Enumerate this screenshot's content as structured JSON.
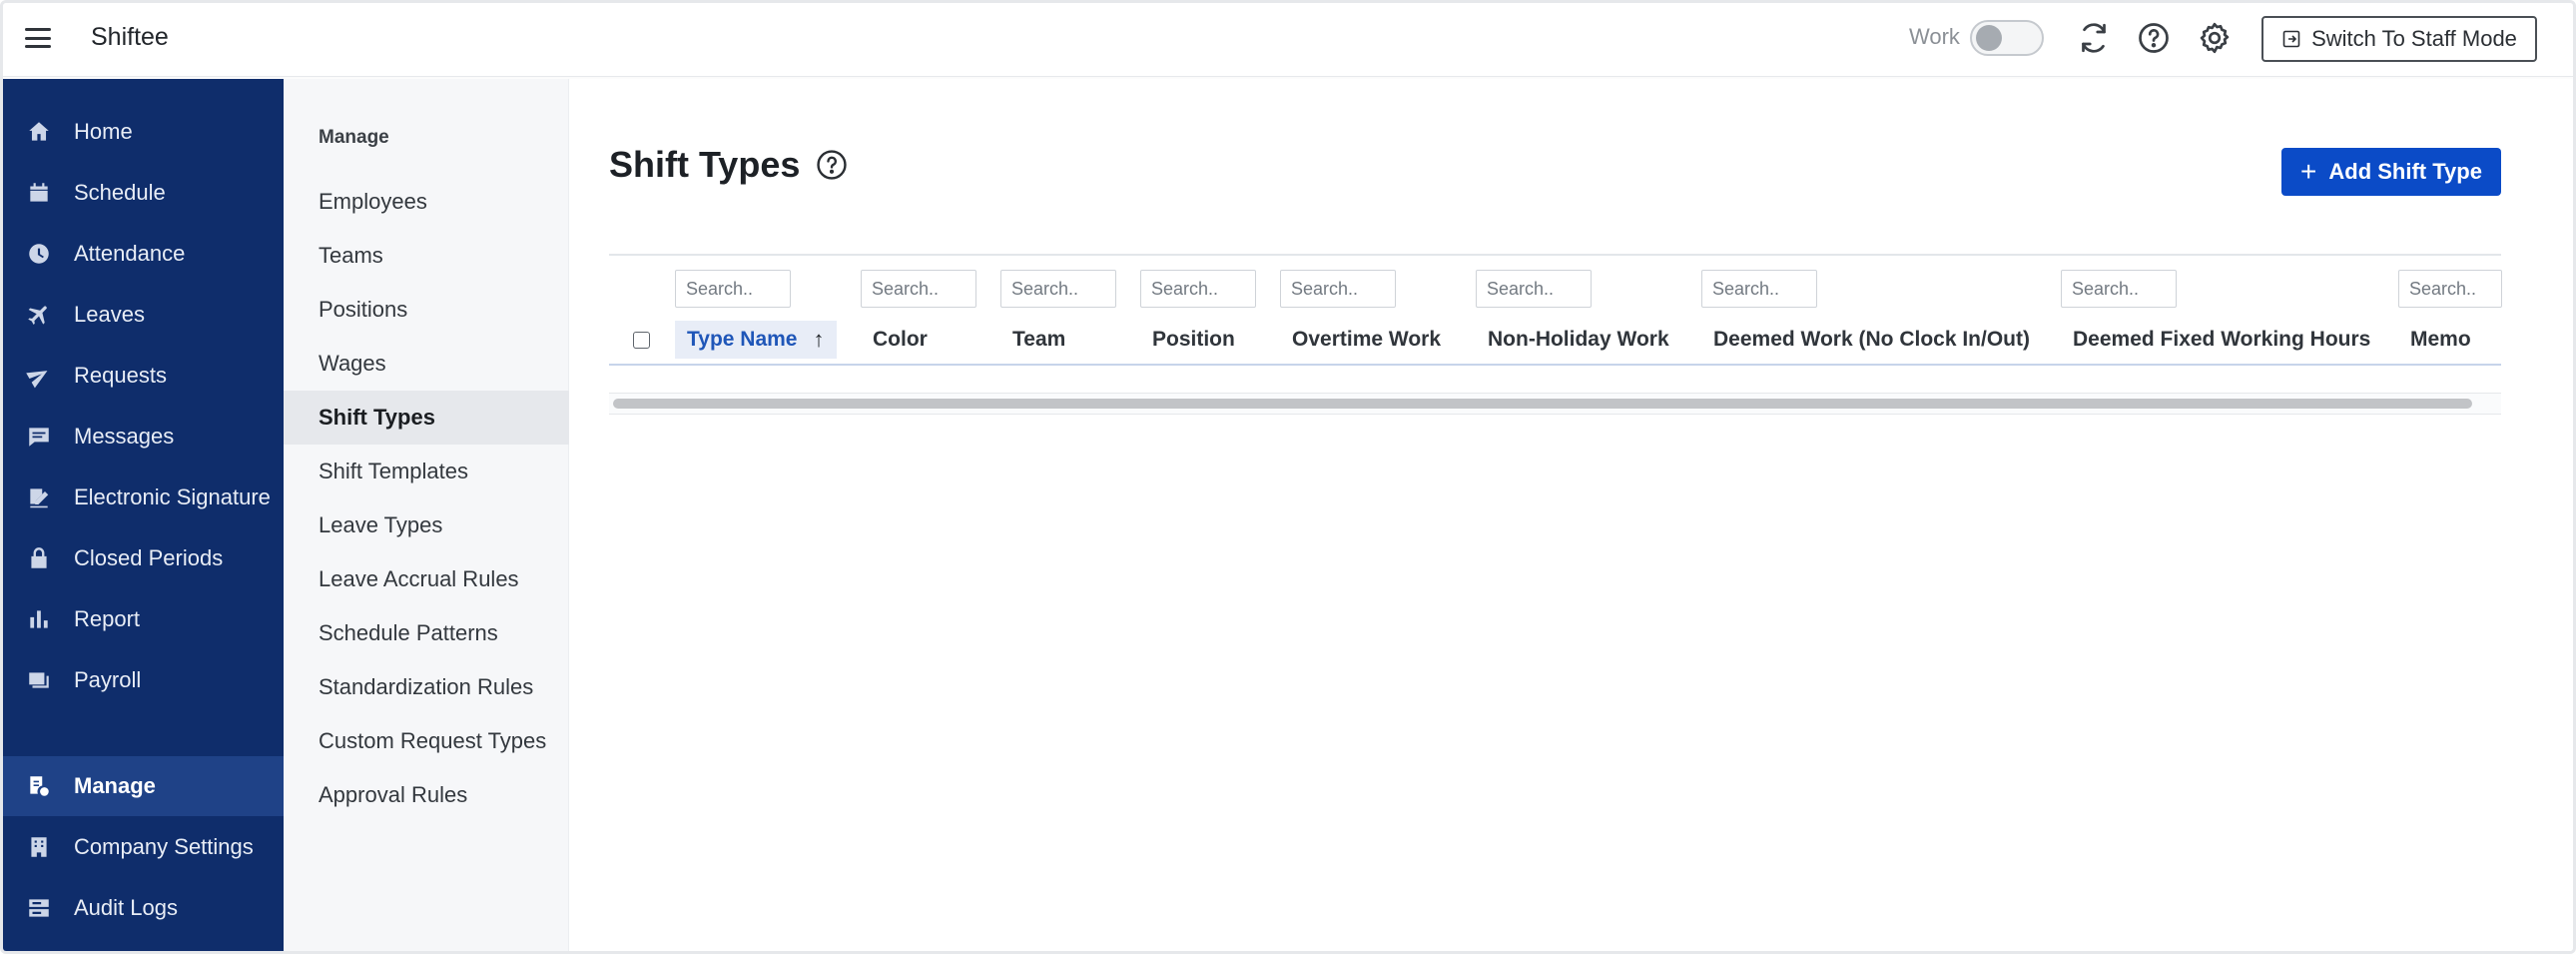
{
  "app": {
    "brand": "Shiftee"
  },
  "topbar": {
    "work_label": "Work",
    "work_toggle_on": false,
    "icons": [
      "refresh-icon",
      "help-icon",
      "gear-icon"
    ],
    "switch_button_label": "Switch To Staff Mode"
  },
  "sidebar": {
    "items": [
      {
        "label": "Home",
        "icon": "home-icon"
      },
      {
        "label": "Schedule",
        "icon": "calendar-icon"
      },
      {
        "label": "Attendance",
        "icon": "clock-icon"
      },
      {
        "label": "Leaves",
        "icon": "airplane-icon"
      },
      {
        "label": "Requests",
        "icon": "send-icon"
      },
      {
        "label": "Messages",
        "icon": "message-icon"
      },
      {
        "label": "Electronic Signature",
        "icon": "signature-icon"
      },
      {
        "label": "Closed Periods",
        "icon": "lock-icon"
      },
      {
        "label": "Report",
        "icon": "bar-chart-icon"
      },
      {
        "label": "Payroll",
        "icon": "payroll-icon"
      },
      {
        "label": "Manage",
        "icon": "manage-icon",
        "active": true
      },
      {
        "label": "Company Settings",
        "icon": "building-icon"
      },
      {
        "label": "Audit Logs",
        "icon": "audit-log-icon"
      }
    ]
  },
  "subnav": {
    "heading": "Manage",
    "items": [
      {
        "label": "Employees"
      },
      {
        "label": "Teams"
      },
      {
        "label": "Positions"
      },
      {
        "label": "Wages"
      },
      {
        "label": "Shift Types",
        "active": true
      },
      {
        "label": "Shift Templates"
      },
      {
        "label": "Leave Types"
      },
      {
        "label": "Leave Accrual Rules"
      },
      {
        "label": "Schedule Patterns"
      },
      {
        "label": "Standardization Rules"
      },
      {
        "label": "Custom Request Types"
      },
      {
        "label": "Approval Rules"
      }
    ]
  },
  "main": {
    "title": "Shift Types",
    "add_button_label": "Add Shift Type",
    "search_placeholder": "Search..",
    "columns": [
      {
        "label": "Type Name",
        "sorted": "asc"
      },
      {
        "label": "Color"
      },
      {
        "label": "Team"
      },
      {
        "label": "Position"
      },
      {
        "label": "Overtime Work"
      },
      {
        "label": "Non-Holiday Work"
      },
      {
        "label": "Deemed Work (No Clock In/Out)"
      },
      {
        "label": "Deemed Fixed Working Hours"
      },
      {
        "label": "Memo"
      }
    ],
    "rows": []
  },
  "colors": {
    "sidebar_bg": "#0f2d6b",
    "sidebar_active": "#1f4287",
    "accent": "#0b4bc7",
    "sorted_header_text": "#1f56b8"
  }
}
